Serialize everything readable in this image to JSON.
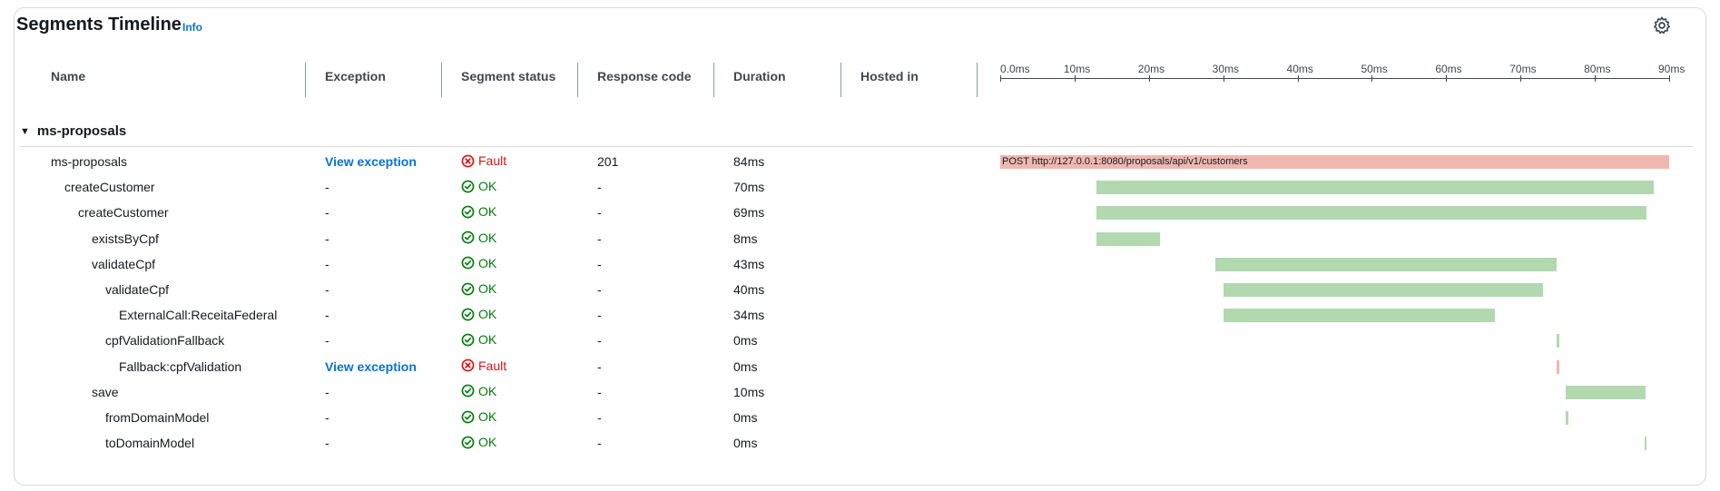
{
  "panel": {
    "title": "Segments Timeline",
    "info_link": "Info",
    "settings_icon": "gear-icon"
  },
  "columns": {
    "name": "Name",
    "exception": "Exception",
    "segment_status": "Segment status",
    "response_code": "Response code",
    "duration": "Duration",
    "hosted_in": "Hosted in"
  },
  "timeline_axis": {
    "ticks": [
      "0.0ms",
      "10ms",
      "20ms",
      "30ms",
      "40ms",
      "50ms",
      "60ms",
      "70ms",
      "80ms",
      "90ms"
    ],
    "range_ms": [
      0,
      90
    ]
  },
  "group": {
    "name": "ms-proposals",
    "expanded": true
  },
  "colors": {
    "ok": "#037f0c",
    "fault": "#d91515",
    "ok_bar": "#b2d8b0",
    "fault_bar": "#f0b7b0",
    "link": "#0972d3"
  },
  "rows": [
    {
      "name": "ms-proposals",
      "depth": 0,
      "exception": "View exception",
      "status": "Fault",
      "response_code": "201",
      "duration": "84ms",
      "start_ms": 0.0,
      "dur_ms": 90.0,
      "bar_label": "POST http://127.0.0.1:8080/proposals/api/v1/customers"
    },
    {
      "name": "createCustomer",
      "depth": 1,
      "exception": "-",
      "status": "OK",
      "response_code": "-",
      "duration": "70ms",
      "start_ms": 12.9,
      "dur_ms": 75.0,
      "bar_label": ""
    },
    {
      "name": "createCustomer",
      "depth": 2,
      "exception": "-",
      "status": "OK",
      "response_code": "-",
      "duration": "69ms",
      "start_ms": 12.9,
      "dur_ms": 74.0,
      "bar_label": ""
    },
    {
      "name": "existsByCpf",
      "depth": 3,
      "exception": "-",
      "status": "OK",
      "response_code": "-",
      "duration": "8ms",
      "start_ms": 12.9,
      "dur_ms": 8.6,
      "bar_label": ""
    },
    {
      "name": "validateCpf",
      "depth": 3,
      "exception": "-",
      "status": "OK",
      "response_code": "-",
      "duration": "43ms",
      "start_ms": 29.0,
      "dur_ms": 45.9,
      "bar_label": ""
    },
    {
      "name": "validateCpf",
      "depth": 4,
      "exception": "-",
      "status": "OK",
      "response_code": "-",
      "duration": "40ms",
      "start_ms": 30.0,
      "dur_ms": 43.0,
      "bar_label": ""
    },
    {
      "name": "ExternalCall:ReceitaFederal",
      "depth": 5,
      "exception": "-",
      "status": "OK",
      "response_code": "-",
      "duration": "34ms",
      "start_ms": 30.0,
      "dur_ms": 36.5,
      "bar_label": ""
    },
    {
      "name": "cpfValidationFallback",
      "depth": 4,
      "exception": "-",
      "status": "OK",
      "response_code": "-",
      "duration": "0ms",
      "start_ms": 74.9,
      "dur_ms": 0.3,
      "bar_label": ""
    },
    {
      "name": "Fallback:cpfValidation",
      "depth": 5,
      "exception": "View exception",
      "status": "Fault",
      "response_code": "-",
      "duration": "0ms",
      "start_ms": 74.9,
      "dur_ms": 0.3,
      "bar_label": ""
    },
    {
      "name": "save",
      "depth": 3,
      "exception": "-",
      "status": "OK",
      "response_code": "-",
      "duration": "10ms",
      "start_ms": 76.1,
      "dur_ms": 10.7,
      "bar_label": ""
    },
    {
      "name": "fromDomainModel",
      "depth": 4,
      "exception": "-",
      "status": "OK",
      "response_code": "-",
      "duration": "0ms",
      "start_ms": 76.1,
      "dur_ms": 0.3,
      "bar_label": ""
    },
    {
      "name": "toDomainModel",
      "depth": 4,
      "exception": "-",
      "status": "OK",
      "response_code": "-",
      "duration": "0ms",
      "start_ms": 86.7,
      "dur_ms": 0.3,
      "bar_label": ""
    }
  ]
}
